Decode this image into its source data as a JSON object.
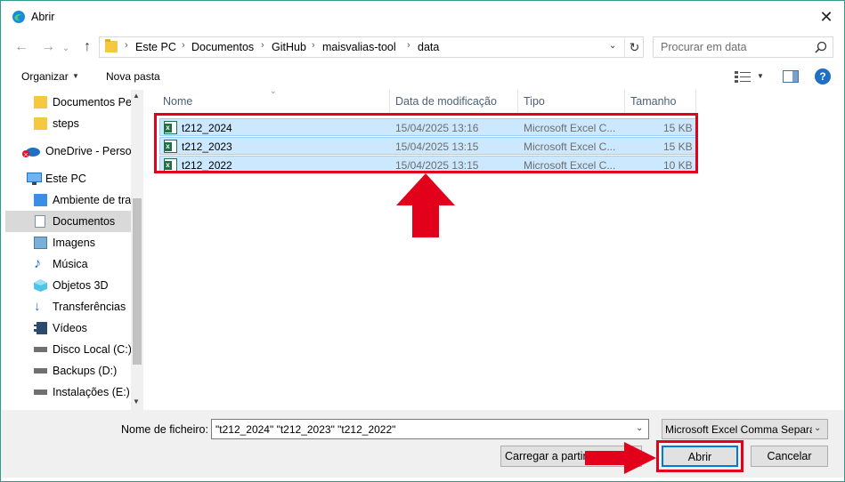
{
  "window": {
    "title": "Abrir",
    "close_glyph": "✕"
  },
  "nav": {
    "back_glyph": "←",
    "forward_glyph": "→",
    "up_glyph": "↑",
    "breadcrumbs": [
      "Este PC",
      "Documentos",
      "GitHub",
      "maisvalias-tool",
      "data"
    ],
    "search_placeholder": "Procurar em data"
  },
  "toolbar": {
    "organize_label": "Organizar",
    "new_folder_label": "Nova pasta"
  },
  "sidebar": {
    "items": [
      {
        "label": "Documentos Pessoais",
        "icon": "folder-icon"
      },
      {
        "label": "steps",
        "icon": "folder-icon"
      },
      {
        "label": "OneDrive - Personal",
        "icon": "onedrive-icon"
      },
      {
        "label": "Este PC",
        "icon": "computer-icon"
      },
      {
        "label": "Ambiente de trabalho",
        "icon": "desktop-icon"
      },
      {
        "label": "Documentos",
        "icon": "documents-icon"
      },
      {
        "label": "Imagens",
        "icon": "images-icon"
      },
      {
        "label": "Música",
        "icon": "music-icon"
      },
      {
        "label": "Objetos 3D",
        "icon": "objects3d-icon"
      },
      {
        "label": "Transferências",
        "icon": "downloads-icon"
      },
      {
        "label": "Vídeos",
        "icon": "videos-icon"
      },
      {
        "label": "Disco Local (C:)",
        "icon": "drive-icon"
      },
      {
        "label": "Backups (D:)",
        "icon": "drive-icon"
      },
      {
        "label": "Instalações (E:)",
        "icon": "drive-icon"
      }
    ],
    "selected": "Documentos"
  },
  "filelist": {
    "columns": [
      "Nome",
      "Data de modificação",
      "Tipo",
      "Tamanho"
    ],
    "files": [
      {
        "name": "t212_2024",
        "date": "15/04/2025 13:16",
        "type": "Microsoft Excel C...",
        "size": "15 KB"
      },
      {
        "name": "t212_2023",
        "date": "15/04/2025 13:15",
        "type": "Microsoft Excel C...",
        "size": "15 KB"
      },
      {
        "name": "t212_2022",
        "date": "15/04/2025 13:15",
        "type": "Microsoft Excel C...",
        "size": "10 KB"
      }
    ]
  },
  "bottom": {
    "filename_label": "Nome de ficheiro:",
    "filename_value": "\"t212_2024\" \"t212_2023\" \"t212_2022\"",
    "filetype_value": "Microsoft Excel Comma Separated",
    "load_label": "Carregar a partir do",
    "open_label": "Abrir",
    "cancel_label": "Cancelar"
  },
  "colors": {
    "selection": "#cce8ff",
    "highlight_red": "#e3001b",
    "accent_blue": "#0078d7"
  }
}
